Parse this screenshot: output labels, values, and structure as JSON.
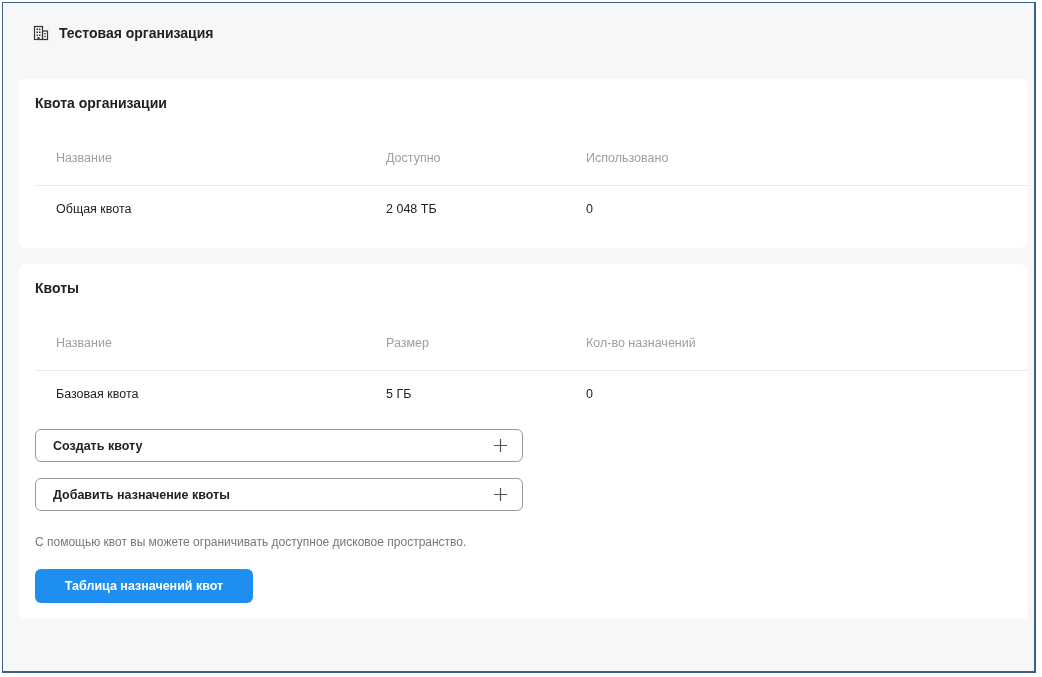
{
  "header": {
    "title": "Тестовая организация"
  },
  "sections": [
    {
      "title": "Квота организации",
      "table": {
        "columns": [
          "Название",
          "Доступно",
          "Использовано"
        ],
        "rows": [
          [
            "Общая квота",
            "2 048 ТБ",
            "0"
          ]
        ]
      }
    },
    {
      "title": "Квоты",
      "table": {
        "columns": [
          "Название",
          "Размер",
          "Кол-во назначений"
        ],
        "rows": [
          [
            "Базовая квота",
            "5 ГБ",
            "0"
          ]
        ]
      },
      "actions": [
        {
          "label": "Создать квоту",
          "kind": "add"
        },
        {
          "label": "Добавить назначение квоты",
          "kind": "add"
        }
      ],
      "hint": "С помощью квот вы можете ограничивать доступное дисковое пространство.",
      "primary_button": "Таблица назначений квот"
    }
  ]
}
